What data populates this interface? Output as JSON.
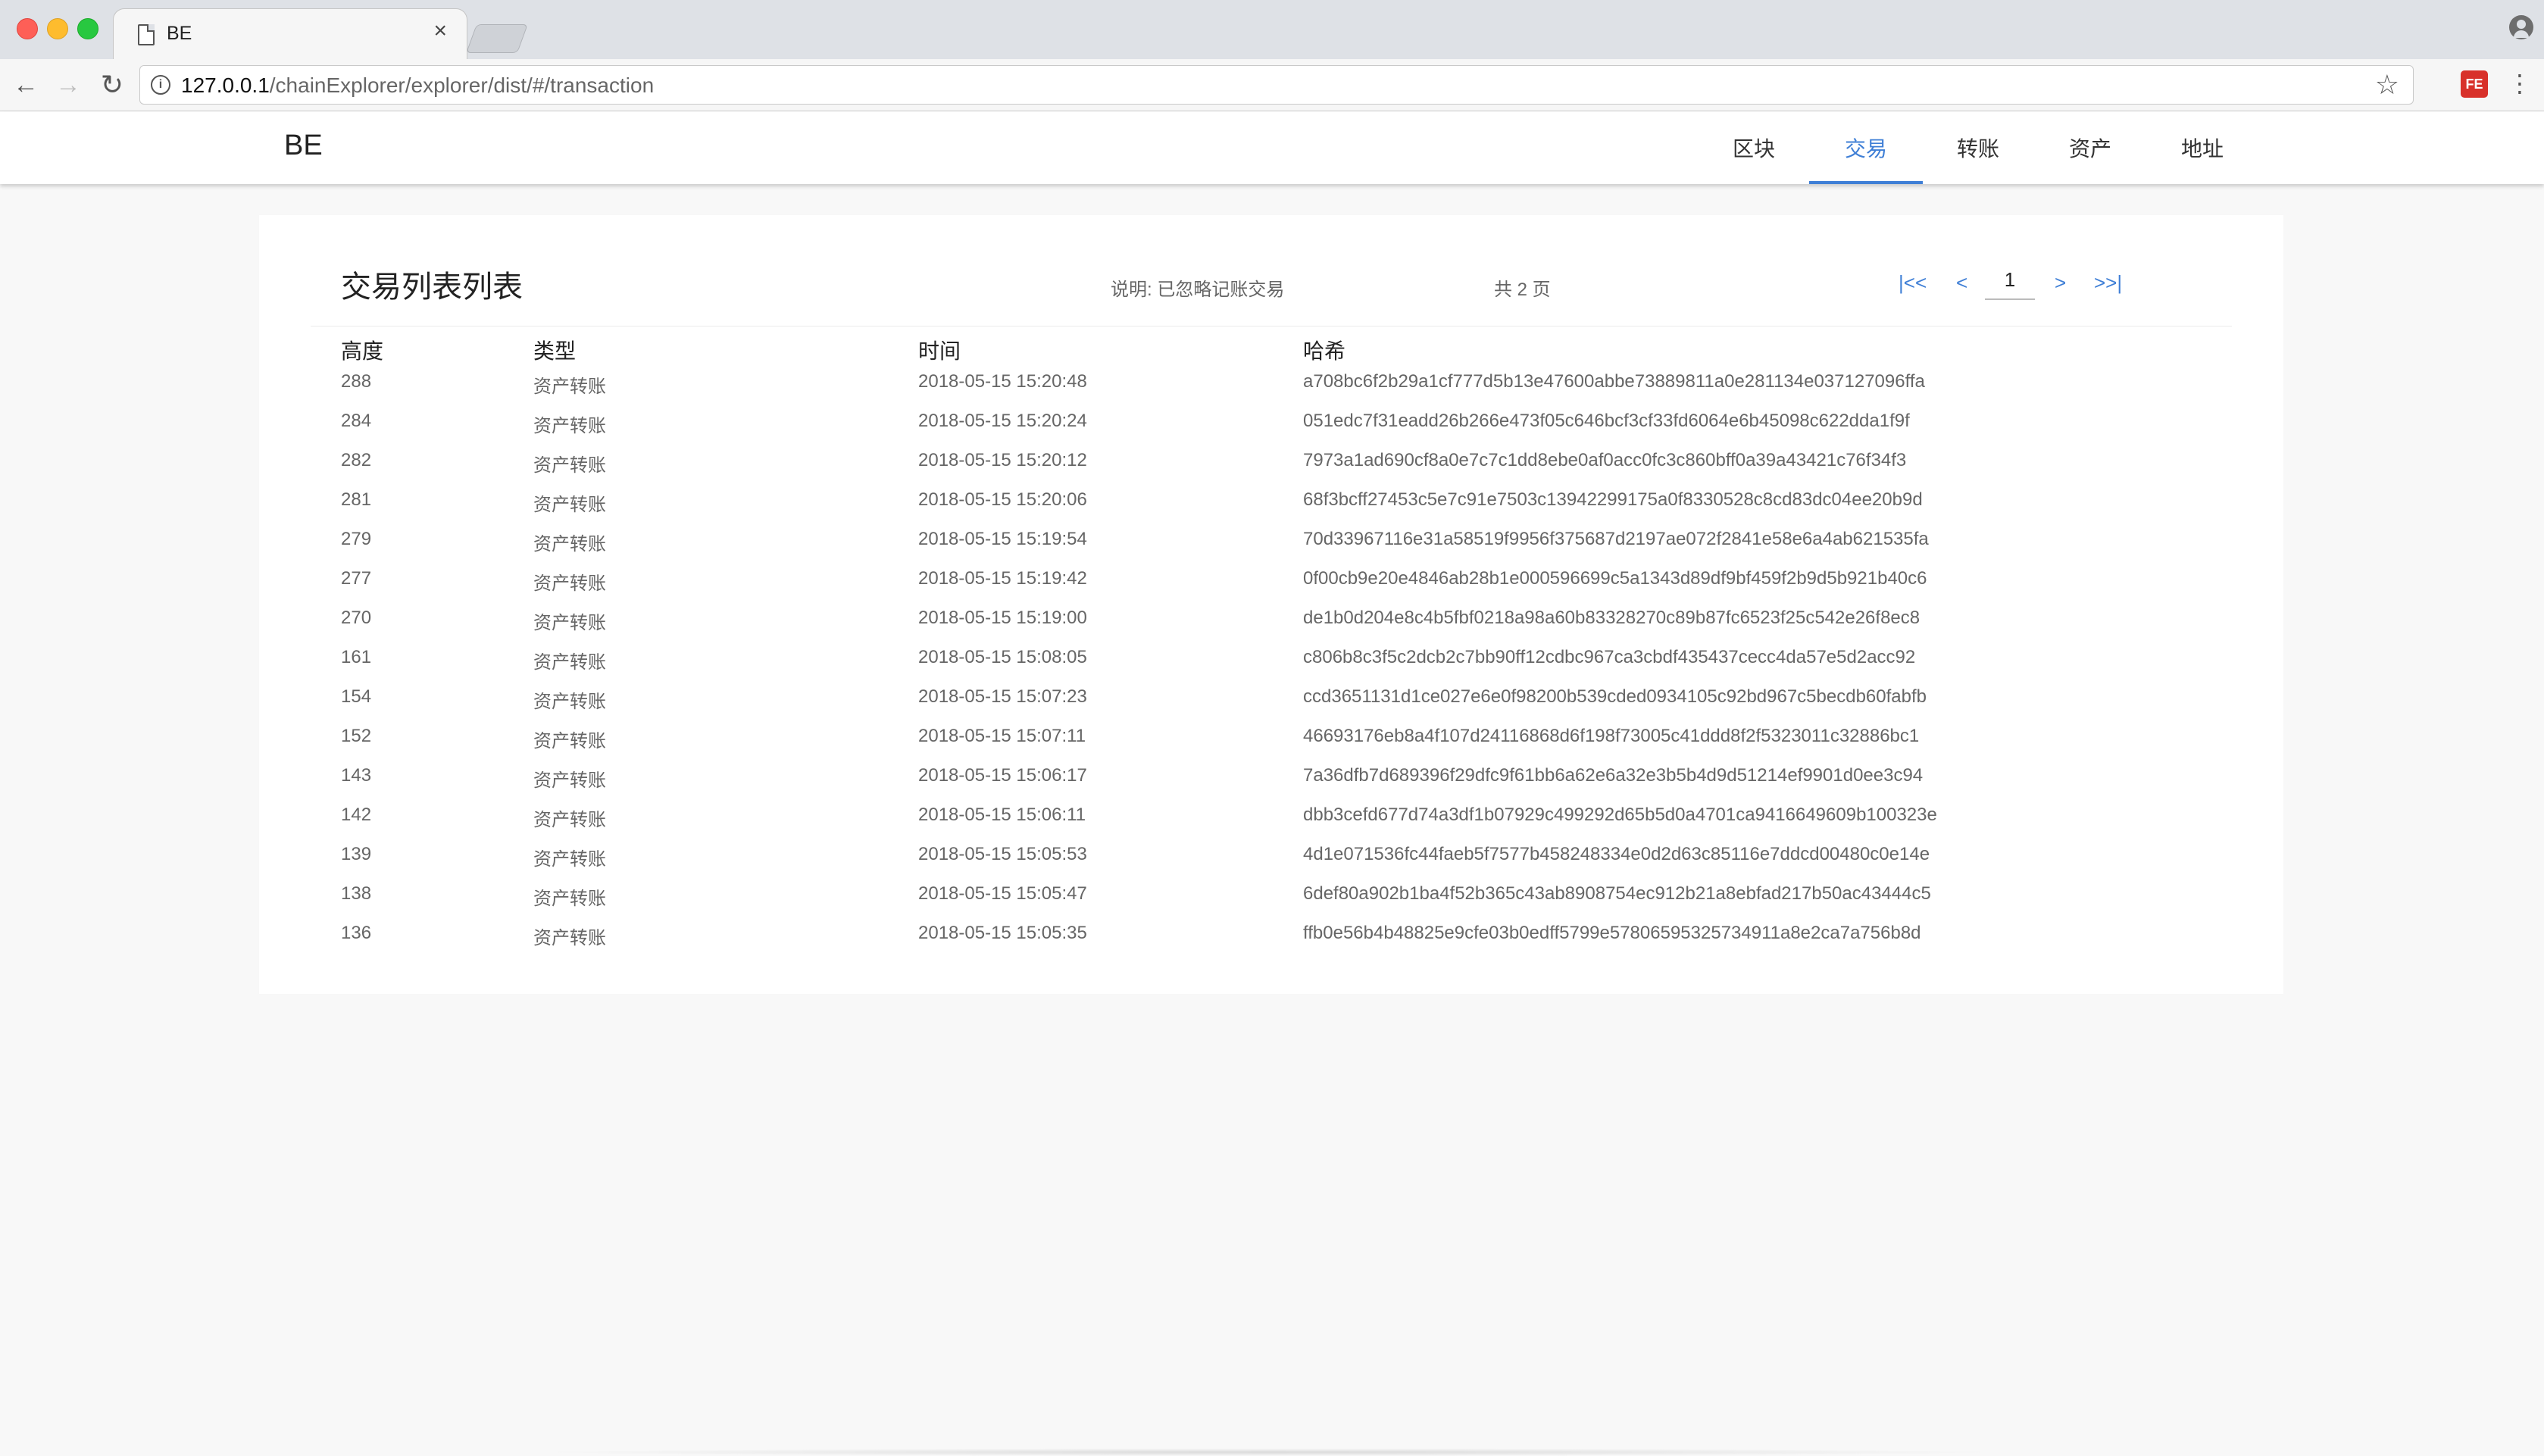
{
  "browser": {
    "tab_title": "BE",
    "tab_close": "×",
    "url_host": "127.0.0.1",
    "url_path": "/chainExplorer/explorer/dist/#/transaction",
    "extension_label": "FE"
  },
  "site": {
    "brand": "BE",
    "nav": [
      {
        "label": "区块",
        "active": false
      },
      {
        "label": "交易",
        "active": true
      },
      {
        "label": "转账",
        "active": false
      },
      {
        "label": "资产",
        "active": false
      },
      {
        "label": "地址",
        "active": false
      }
    ],
    "accent_color": "#3f7fd6"
  },
  "list": {
    "title": "交易列表列表",
    "note": "说明: 已忽略记账交易",
    "total_pages": "共 2 页",
    "pager": {
      "first": "|<<",
      "prev": "<",
      "current": "1",
      "next": ">",
      "last": ">>|"
    },
    "columns": [
      "高度",
      "类型",
      "时间",
      "哈希"
    ],
    "rows": [
      {
        "height": "288",
        "type": "资产转账",
        "time": "2018-05-15 15:20:48",
        "hash": "a708bc6f2b29a1cf777d5b13e47600abbe73889811a0e281134e037127096ffa"
      },
      {
        "height": "284",
        "type": "资产转账",
        "time": "2018-05-15 15:20:24",
        "hash": "051edc7f31eadd26b266e473f05c646bcf3cf33fd6064e6b45098c622dda1f9f"
      },
      {
        "height": "282",
        "type": "资产转账",
        "time": "2018-05-15 15:20:12",
        "hash": "7973a1ad690cf8a0e7c7c1dd8ebe0af0acc0fc3c860bff0a39a43421c76f34f3"
      },
      {
        "height": "281",
        "type": "资产转账",
        "time": "2018-05-15 15:20:06",
        "hash": "68f3bcff27453c5e7c91e7503c13942299175a0f8330528c8cd83dc04ee20b9d"
      },
      {
        "height": "279",
        "type": "资产转账",
        "time": "2018-05-15 15:19:54",
        "hash": "70d33967116e31a58519f9956f375687d2197ae072f2841e58e6a4ab621535fa"
      },
      {
        "height": "277",
        "type": "资产转账",
        "time": "2018-05-15 15:19:42",
        "hash": "0f00cb9e20e4846ab28b1e000596699c5a1343d89df9bf459f2b9d5b921b40c6"
      },
      {
        "height": "270",
        "type": "资产转账",
        "time": "2018-05-15 15:19:00",
        "hash": "de1b0d204e8c4b5fbf0218a98a60b83328270c89b87fc6523f25c542e26f8ec8"
      },
      {
        "height": "161",
        "type": "资产转账",
        "time": "2018-05-15 15:08:05",
        "hash": "c806b8c3f5c2dcb2c7bb90ff12cdbc967ca3cbdf435437cecc4da57e5d2acc92"
      },
      {
        "height": "154",
        "type": "资产转账",
        "time": "2018-05-15 15:07:23",
        "hash": "ccd3651131d1ce027e6e0f98200b539cded0934105c92bd967c5becdb60fabfb"
      },
      {
        "height": "152",
        "type": "资产转账",
        "time": "2018-05-15 15:07:11",
        "hash": "46693176eb8a4f107d24116868d6f198f73005c41ddd8f2f5323011c32886bc1"
      },
      {
        "height": "143",
        "type": "资产转账",
        "time": "2018-05-15 15:06:17",
        "hash": "7a36dfb7d689396f29dfc9f61bb6a62e6a32e3b5b4d9d51214ef9901d0ee3c94"
      },
      {
        "height": "142",
        "type": "资产转账",
        "time": "2018-05-15 15:06:11",
        "hash": "dbb3cefd677d74a3df1b07929c499292d65b5d0a4701ca9416649609b100323e"
      },
      {
        "height": "139",
        "type": "资产转账",
        "time": "2018-05-15 15:05:53",
        "hash": "4d1e071536fc44faeb5f7577b458248334e0d2d63c85116e7ddcd00480c0e14e"
      },
      {
        "height": "138",
        "type": "资产转账",
        "time": "2018-05-15 15:05:47",
        "hash": "6def80a902b1ba4f52b365c43ab8908754ec912b21a8ebfad217b50ac43444c5"
      },
      {
        "height": "136",
        "type": "资产转账",
        "time": "2018-05-15 15:05:35",
        "hash": "ffb0e56b4b48825e9cfe03b0edff5799e57806595325734911a8e2ca7a756b8d"
      }
    ]
  }
}
